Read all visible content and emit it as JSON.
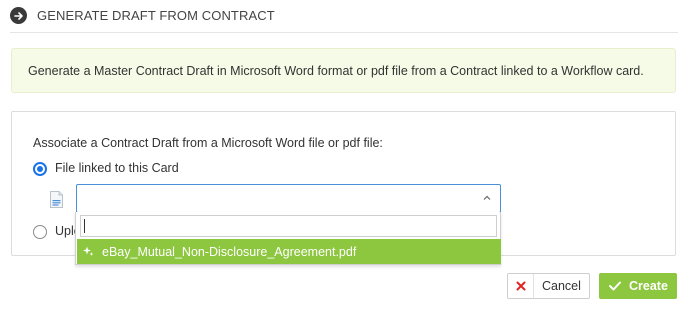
{
  "header": {
    "title": "GENERATE DRAFT FROM CONTRACT",
    "icon": "arrow-right-circle-icon"
  },
  "info": {
    "text": "Generate a Master Contract Draft in Microsoft Word format or pdf file from a Contract linked to a Workflow card."
  },
  "panel": {
    "label": "Associate a Contract Draft from a Microsoft Word file or pdf file:",
    "options": [
      {
        "label": "File linked to this Card",
        "checked": true
      },
      {
        "label": "Uplo",
        "checked": false
      }
    ],
    "select": {
      "value": ""
    },
    "dropdown": {
      "search_value": "",
      "items": [
        {
          "label": "eBay_Mutual_Non-Disclosure_Agreement.pdf",
          "highlighted": true
        }
      ]
    }
  },
  "actions": {
    "cancel_label": "Cancel",
    "create_label": "Create"
  },
  "colors": {
    "accent_green": "#8dc63f",
    "radio_blue": "#1a73e8",
    "info_bg": "#f6fbe7",
    "cancel_x": "#e02424"
  }
}
